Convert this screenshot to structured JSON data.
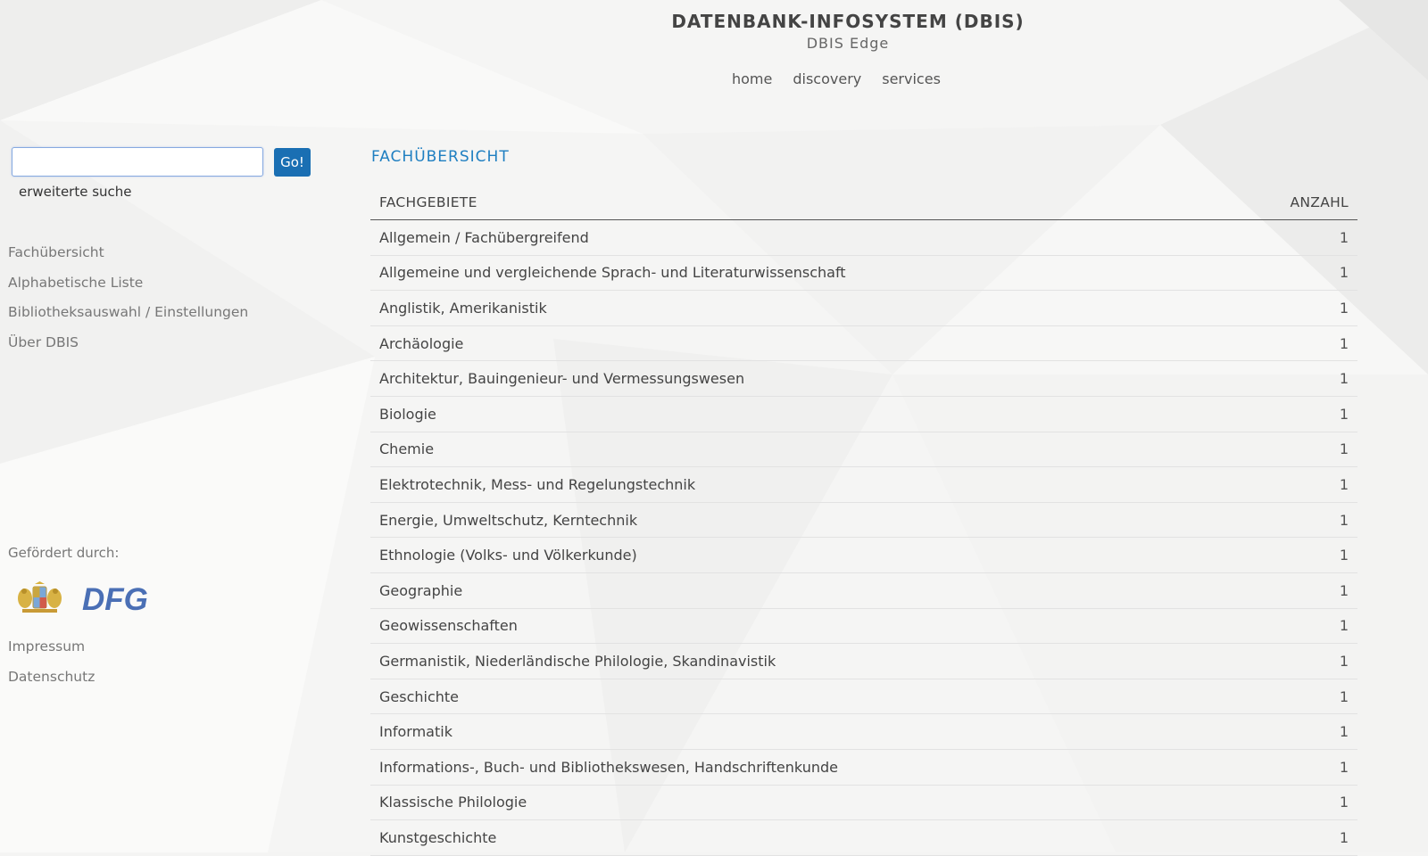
{
  "header": {
    "title": "DATENBANK-INFOSYSTEM (DBIS)",
    "subtitle": "DBIS Edge",
    "nav": [
      "home",
      "discovery",
      "services"
    ]
  },
  "search": {
    "value": "",
    "go_label": "Go!",
    "advanced_label": "erweiterte suche"
  },
  "sidebar": {
    "items": [
      "Fachübersicht",
      "Alphabetische Liste",
      "Bibliotheksauswahl / Einstellungen",
      "Über DBIS"
    ],
    "funded_label": "Gefördert durch:",
    "logos": {
      "dfg_text": "DFG",
      "dfg_color": "#4a6fb5",
      "bavaria_icon": "bavarian-coat-of-arms-icon"
    },
    "footer_items": [
      "Impressum",
      "Datenschutz"
    ]
  },
  "main": {
    "section_title": "FACHÜBERSICHT",
    "columns": [
      "FACHGEBIETE",
      "ANZAHL"
    ],
    "rows": [
      {
        "subject": "Allgemein / Fachübergreifend",
        "count": "1"
      },
      {
        "subject": "Allgemeine und vergleichende Sprach- und Literaturwissenschaft",
        "count": "1"
      },
      {
        "subject": "Anglistik, Amerikanistik",
        "count": "1"
      },
      {
        "subject": "Archäologie",
        "count": "1"
      },
      {
        "subject": "Architektur, Bauingenieur- und Vermessungswesen",
        "count": "1"
      },
      {
        "subject": "Biologie",
        "count": "1"
      },
      {
        "subject": "Chemie",
        "count": "1"
      },
      {
        "subject": "Elektrotechnik, Mess- und Regelungstechnik",
        "count": "1"
      },
      {
        "subject": "Energie, Umweltschutz, Kerntechnik",
        "count": "1"
      },
      {
        "subject": "Ethnologie (Volks- und Völkerkunde)",
        "count": "1"
      },
      {
        "subject": "Geographie",
        "count": "1"
      },
      {
        "subject": "Geowissenschaften",
        "count": "1"
      },
      {
        "subject": "Germanistik, Niederländische Philologie, Skandinavistik",
        "count": "1"
      },
      {
        "subject": "Geschichte",
        "count": "1"
      },
      {
        "subject": "Informatik",
        "count": "1"
      },
      {
        "subject": "Informations-, Buch- und Bibliothekswesen, Handschriftenkunde",
        "count": "1"
      },
      {
        "subject": "Klassische Philologie",
        "count": "1"
      },
      {
        "subject": "Kunstgeschichte",
        "count": "1"
      }
    ]
  },
  "colors": {
    "accent": "#1f7fc1",
    "button": "#1a6fb3",
    "background": "#f4f4f3"
  }
}
